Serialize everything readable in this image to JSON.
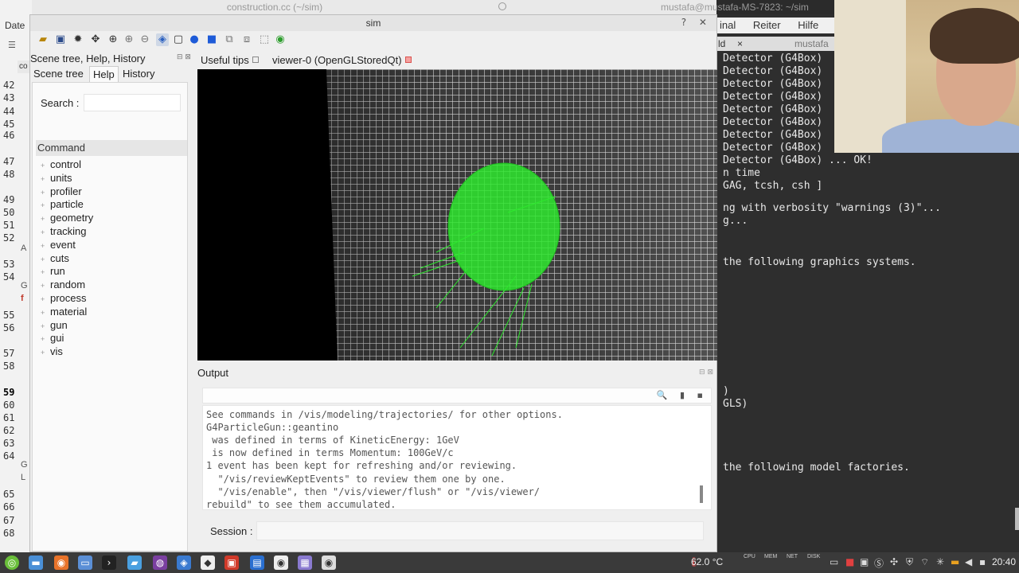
{
  "background": {
    "editor_title": "construction.cc (~/sim)",
    "editor_menu": "Date",
    "editor_tab": "co",
    "line_numbers": [
      "42",
      "43",
      "44",
      "45",
      "46",
      "47",
      "48",
      "49",
      "50",
      "51",
      "52",
      "53",
      "54",
      "55",
      "56",
      "57",
      "58",
      "59",
      "60",
      "61",
      "62",
      "63",
      "64",
      "65",
      "66",
      "67",
      "68"
    ],
    "current_line": "59",
    "side_letters": [
      "A",
      "G",
      "f",
      "G",
      "L"
    ],
    "terminal_title": "mustafa@mustafa-MS-7823: ~/sim"
  },
  "terminal": {
    "menu": [
      "inal",
      "Reiter",
      "Hilfe"
    ],
    "tab_label": "ld",
    "tab_close": "×",
    "tab2_label": "mustafa",
    "lines": [
      "Detector (G4Box)",
      "Detector (G4Box)",
      "Detector (G4Box)",
      "Detector (G4Box)",
      "Detector (G4Box)",
      "Detector (G4Box)",
      "Detector (G4Box)",
      "Detector (G4Box)",
      "Detector (G4Box) ... OK!",
      "n time",
      "GAG, tcsh, csh ]",
      "ng with verbosity \"warnings (3)\"...",
      "g...",
      "the following graphics systems.",
      ")",
      "GLS)",
      "the following model factories."
    ]
  },
  "sim": {
    "title": "sim",
    "title_buttons": "? ✕",
    "dock_title": "Scene tree, Help, History",
    "dock_buttons": "⊟ ⊠",
    "tabs": [
      "Scene tree",
      "Help",
      "History"
    ],
    "active_tab": "Help",
    "search_label": "Search :",
    "search_value": "",
    "command_header": "Command",
    "commands": [
      "control",
      "units",
      "profiler",
      "particle",
      "geometry",
      "tracking",
      "event",
      "cuts",
      "run",
      "random",
      "process",
      "material",
      "gun",
      "gui",
      "vis"
    ],
    "viewer_tabs": {
      "tips": "Useful tips",
      "viewer": "viewer-0 (OpenGLStoredQt)"
    },
    "output": {
      "title": "Output",
      "buttons": "⊟ ⊠",
      "filter_icons": "🔍 ▮ ▪",
      "lines": [
        "See commands in /vis/modeling/trajectories/ for other options.",
        "G4ParticleGun::geantino",
        " was defined in terms of KineticEnergy: 1GeV",
        " is now defined in terms Momentum: 100GeV/c",
        "1 event has been kept for refreshing and/or reviewing.",
        "  \"/vis/reviewKeptEvents\" to review them one by one.",
        "  \"/vis/enable\", then \"/vis/viewer/flush\" or \"/vis/viewer/",
        "rebuild\" to see them accumulated."
      ]
    },
    "session_label": "Session :",
    "session_value": ""
  },
  "taskbar": {
    "temperature": "62.0 °C",
    "sysmon_labels": [
      "CPU",
      "MEM",
      "NET",
      "DISK"
    ],
    "clock": "20:40"
  },
  "colors": {
    "viewer_bg": "#000000",
    "mesh": "#d8d8d8",
    "track_green": "#2ee82e",
    "accent_red": "#d9534f"
  }
}
